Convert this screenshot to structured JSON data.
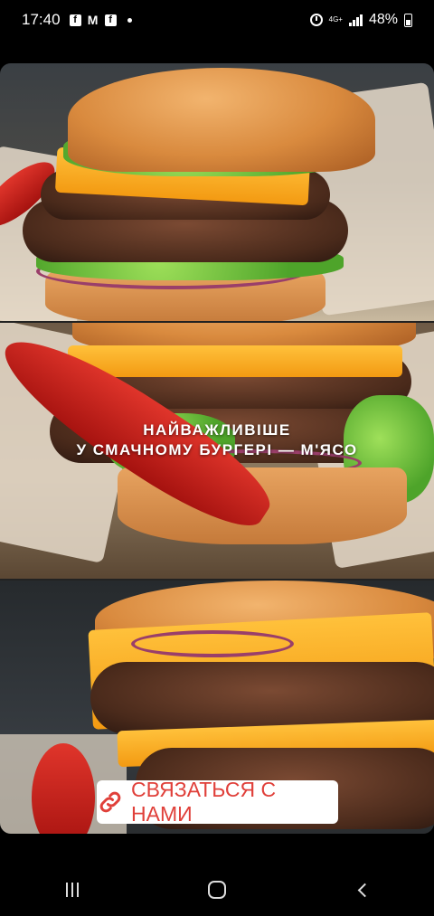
{
  "status_bar": {
    "time": "17:40",
    "notification_icons": [
      "facebook-icon",
      "gmail-icon",
      "facebook-icon"
    ],
    "network": "4G+",
    "battery": "48%"
  },
  "story": {
    "caption_line1": "НАЙВАЖЛИВІШЕ",
    "caption_line2": "У СМАЧНОМУ БУРГЕРІ — М'ЯСО",
    "cta_label": "СВЯЗАТЬСЯ С НАМИ",
    "cta_icon": "link-icon",
    "accent_color": "#e0403a"
  },
  "nav_bar": {
    "buttons": [
      "recent-apps-button",
      "home-button",
      "back-button"
    ]
  }
}
